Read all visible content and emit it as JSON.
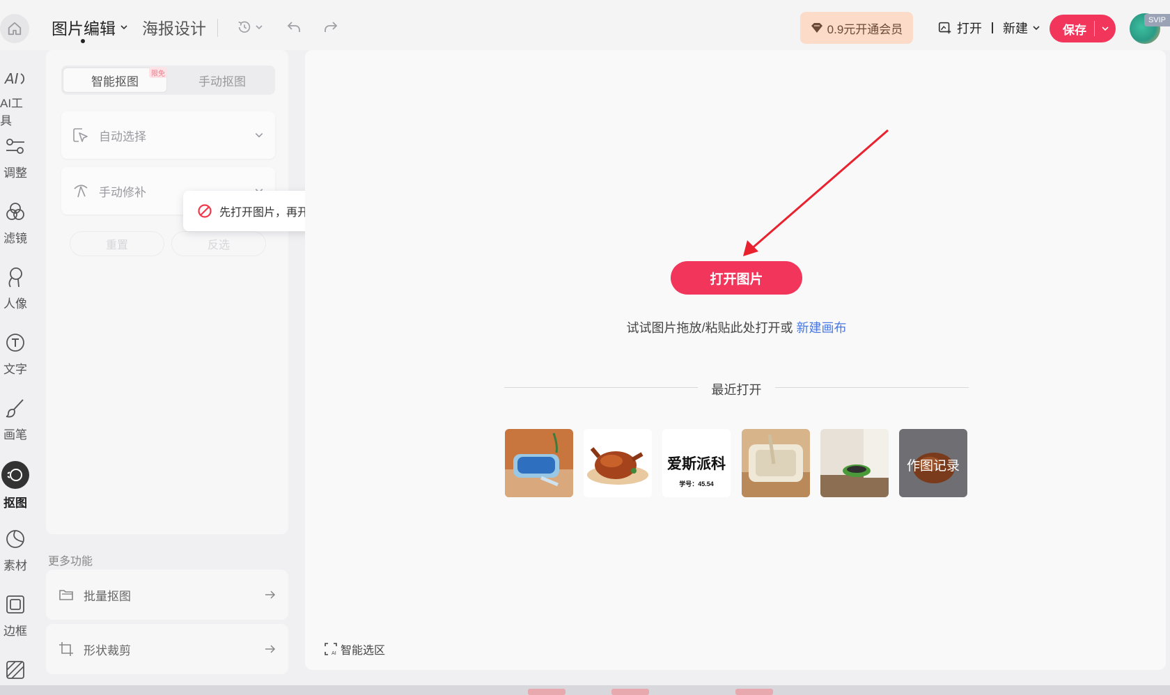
{
  "header": {
    "mode_tabs": [
      "图片编辑",
      "海报设计"
    ],
    "vip_label": "0.9元开通会员",
    "open_label": "打开",
    "new_label": "新建",
    "save_label": "保存",
    "svip_label": "SVIP"
  },
  "rail": {
    "items": [
      "AI工具",
      "调整",
      "滤镜",
      "人像",
      "文字",
      "画笔",
      "抠图",
      "素材",
      "边框"
    ],
    "active_item": "抠图"
  },
  "panel": {
    "tabs": [
      "智能抠图",
      "手动抠图"
    ],
    "limit_badge": "限免",
    "options": [
      "自动选择",
      "手动修补"
    ],
    "buttons": [
      "重置",
      "反选"
    ],
    "toast": "先打开图片，再开始操作吧"
  },
  "more": {
    "title": "更多功能",
    "items": [
      "批量抠图",
      "形状裁剪"
    ]
  },
  "canvas": {
    "open_image_label": "打开图片",
    "hint_text": "试试图片拖放/粘贴此处打开或",
    "hint_link": "新建画布",
    "recent_title": "最近打开",
    "history_label": "作图记录",
    "brand_thumb_title": "爱斯派科",
    "brand_thumb_sub": "学号：45.54",
    "smart_select_label": "智能选区"
  },
  "colors": {
    "accent": "#f2355a",
    "link": "#4a78e0",
    "arrow": "#e8222e"
  }
}
